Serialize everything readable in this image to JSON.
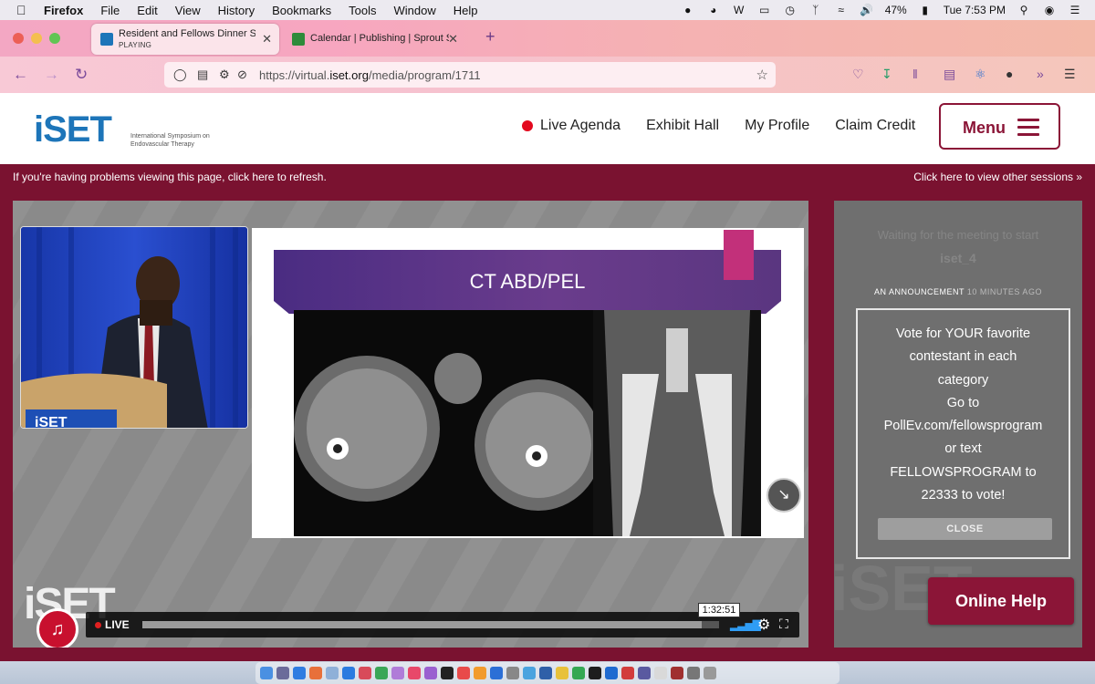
{
  "menubar": {
    "apple_icon": "apple-icon",
    "app_name": "Firefox",
    "items": [
      "File",
      "Edit",
      "View",
      "History",
      "Bookmarks",
      "Tools",
      "Window",
      "Help"
    ],
    "battery": "47%",
    "clock": "Tue 7:53 PM"
  },
  "browser": {
    "tabs": [
      {
        "title": "Resident and Fellows Dinner Ses",
        "status": "PLAYING",
        "active": true
      },
      {
        "title": "Calendar | Publishing | Sprout S",
        "active": false
      }
    ],
    "url_host_prefix": "https://virtual.",
    "url_host": "iset.org",
    "url_path": "/media/program/1711"
  },
  "site": {
    "logo_text": "iSET",
    "logo_sub": "International Symposium on Endovascular Therapy",
    "nav": {
      "live_agenda": "Live Agenda",
      "exhibit_hall": "Exhibit Hall",
      "my_profile": "My Profile",
      "claim_credit": "Claim Credit",
      "menu": "Menu"
    },
    "notice_left": "If you're having problems viewing this page, click here to refresh.",
    "notice_right": "Click here to view other sessions »"
  },
  "video": {
    "slide_title": "CT ABD/PEL",
    "watermark": "iSET",
    "live_label": "LIVE",
    "time_tooltip": "1:32:51",
    "progress": 0.97
  },
  "chat": {
    "waiting": "Waiting for the meeting to start",
    "room": "iset_4",
    "announcement_label": "AN ANNOUNCEMENT",
    "announcement_time": "10 MINUTES AGO",
    "message_lines": [
      "Vote for YOUR favorite",
      "contestant in each",
      "category",
      "Go to",
      "PollEv.com/fellowsprogram",
      "or text",
      "FELLOWSPROGRAM to",
      "22333 to vote!"
    ],
    "close": "CLOSE",
    "watermark": "iSET",
    "online_help": "Online Help"
  },
  "colors": {
    "brand_maroon": "#7a1230",
    "brand_blue": "#1d75b9",
    "live_red": "#e3091e"
  }
}
